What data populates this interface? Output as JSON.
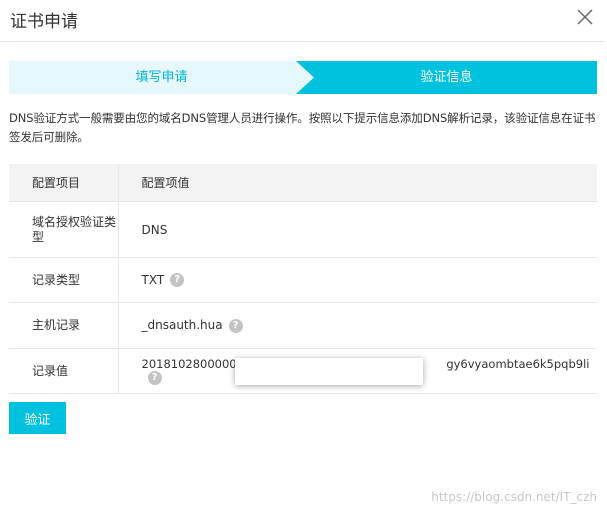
{
  "dialog": {
    "title": "证书申请"
  },
  "steps": [
    {
      "label": "填写申请"
    },
    {
      "label": "验证信息"
    }
  ],
  "description": "DNS验证方式一般需要由您的域名DNS管理人员进行操作。按照以下提示信息添加DNS解析记录，该验证信息在证书签发后可删除。",
  "table": {
    "headers": [
      "配置项目",
      "配置项值"
    ],
    "rows": [
      {
        "label": "域名授权验证类型",
        "value": "DNS"
      },
      {
        "label": "记录类型",
        "value": "TXT"
      },
      {
        "label": "主机记录",
        "value": "_dnsauth.hua"
      },
      {
        "label": "记录值",
        "value": "201810280000004e",
        "value_suffix": "gy6vyaombtae6k5pqb9li"
      }
    ]
  },
  "actions": {
    "verify_label": "验证"
  },
  "watermark": "https://blog.csdn.net/IT_czh",
  "colors": {
    "accent": "#00c1de",
    "step_inactive_bg": "#e6f8fb"
  },
  "icons": {
    "close": "close-icon",
    "help": "question-circle-icon"
  }
}
